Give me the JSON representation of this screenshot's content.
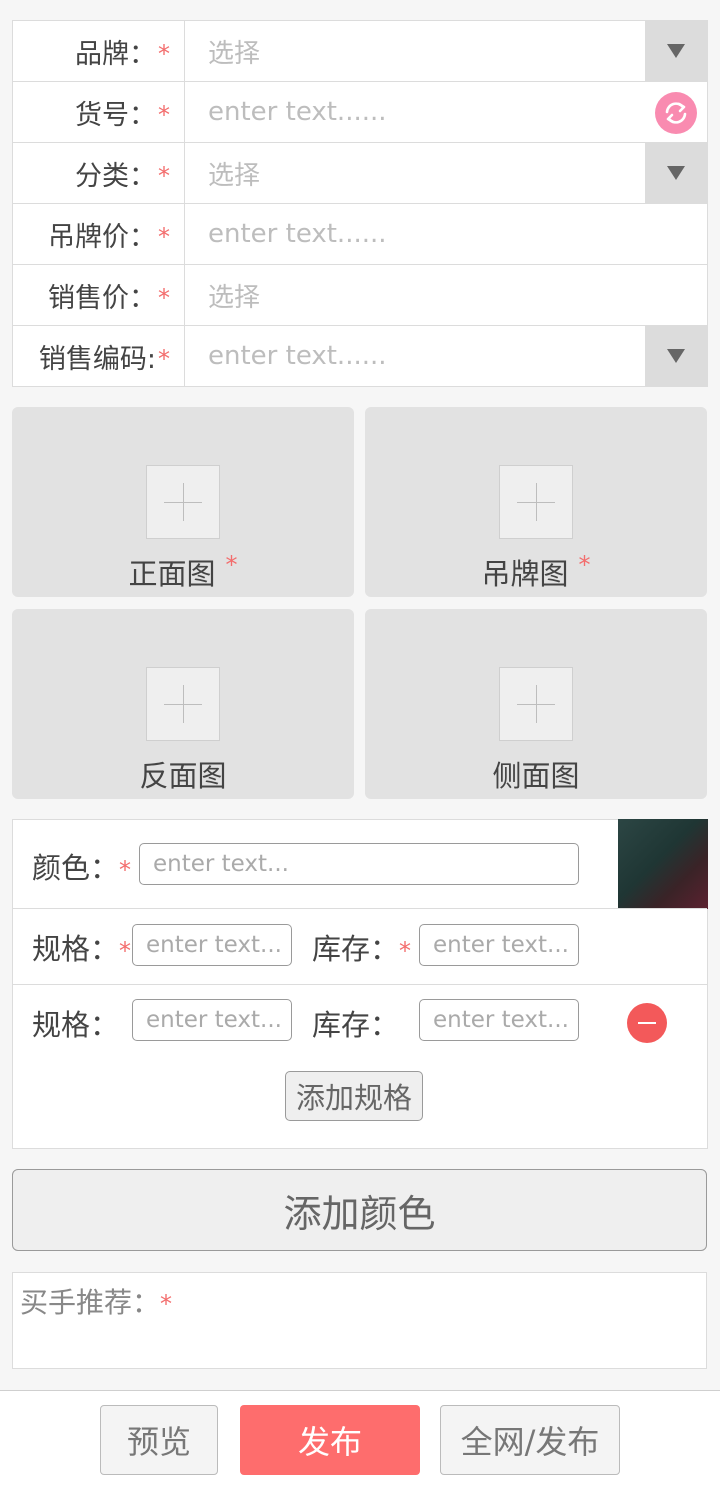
{
  "form": {
    "rows": [
      {
        "label": "品牌：",
        "required": "*",
        "value": "选择",
        "control": "dropdown"
      },
      {
        "label": "货号：",
        "required": "*",
        "value": "enter text......",
        "control": "refresh"
      },
      {
        "label": "分类：",
        "required": "*",
        "value": "选择",
        "control": "dropdown"
      },
      {
        "label": "吊牌价：",
        "required": "*",
        "value": "enter text......",
        "control": "none"
      },
      {
        "label": "销售价：",
        "required": "*",
        "value": "选择",
        "control": "none"
      },
      {
        "label": "销售编码:",
        "required": "*",
        "value": "enter text......",
        "control": "dropdown"
      }
    ]
  },
  "images": {
    "front": {
      "label": "正面图",
      "required": "*"
    },
    "tag": {
      "label": "吊牌图",
      "required": "*"
    },
    "back": {
      "label": "反面图"
    },
    "side": {
      "label": "侧面图"
    }
  },
  "color_panel": {
    "color_label": "颜色：",
    "color_required": "*",
    "color_placeholder": "enter text...",
    "spec_rows": [
      {
        "spec_label": "规格：",
        "spec_required": "*",
        "spec_placeholder": "enter text...",
        "stock_label": "库存：",
        "stock_required": "*",
        "stock_placeholder": "enter text..."
      },
      {
        "spec_label": "规格：",
        "spec_placeholder": "enter text...",
        "stock_label": "库存：",
        "stock_placeholder": "enter text..."
      }
    ],
    "add_spec_label": "添加规格"
  },
  "add_color_label": "添加颜色",
  "buyer": {
    "label": "买手推荐：",
    "required": "*"
  },
  "bottom_bar": {
    "preview": "预览",
    "publish": "发布",
    "publish_all": "全网/发布"
  },
  "colors": {
    "accent": "#fe6d6d",
    "required_star": "#f36d6d",
    "refresh": "#f98bb0",
    "remove": "#f3595a"
  }
}
